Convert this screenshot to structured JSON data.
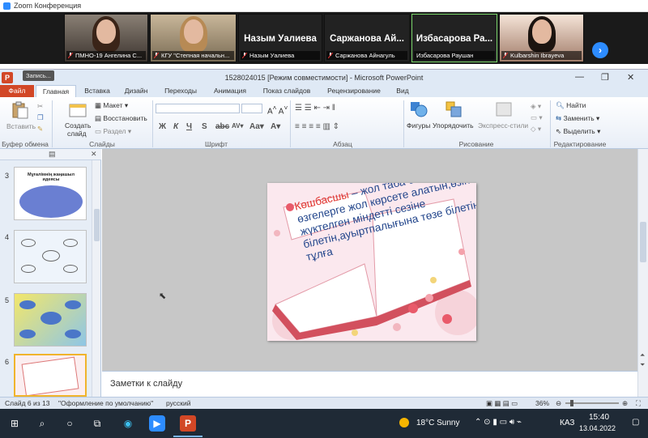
{
  "zoom": {
    "title": "Zoom Конференция",
    "participants": [
      {
        "label": "ПМНО-19 Ангелина С...",
        "name": ""
      },
      {
        "label": "КГУ \"Степная начальн...",
        "name": ""
      },
      {
        "label": "Назым Уалиева",
        "name": "Назым Уалиева"
      },
      {
        "label": "Саржанова Айнагуль",
        "name": "Саржанова Ай..."
      },
      {
        "label": "Избасарова Раушан",
        "name": "Избасарова Ра..."
      },
      {
        "label": "Kulbarshin Ibrayeva",
        "name": ""
      }
    ]
  },
  "powerpoint": {
    "record_label": "Запись...",
    "doc_title": "1528024015 [Режим совместимости] - Microsoft PowerPoint",
    "tabs": [
      "Файл",
      "Главная",
      "Вставка",
      "Дизайн",
      "Переходы",
      "Анимация",
      "Показ слайдов",
      "Рецензирование",
      "Вид"
    ],
    "ribbon": {
      "paste": "Вставить",
      "clipboard": "Буфер обмена",
      "create_slide_1": "Создать",
      "create_slide_2": "слайд",
      "layout": "Макет",
      "reset": "Восстановить",
      "section": "Раздел",
      "slides": "Слайды",
      "font": "Шрифт",
      "paragraph": "Абзац",
      "shapes": "Фигуры",
      "arrange": "Упорядочить",
      "express_styles": "Экспресс-стили",
      "drawing": "Рисование",
      "find": "Найти",
      "replace": "Заменить",
      "select": "Выделить",
      "editing": "Редактирование"
    },
    "thumbnails": [
      {
        "num": "3",
        "title": "Мұғалімнің жаңашыл идеясы"
      },
      {
        "num": "4"
      },
      {
        "num": "5"
      },
      {
        "num": "6"
      }
    ],
    "slide": {
      "highlight": "Көшбасшы",
      "text": " – жол таба білетін, өзгелерге жол көрсете алатын,өзіне жүктелген міндетті сезіне білетін,ауыртпалығына төзе білетін тұлға"
    },
    "notes_placeholder": "Заметки к слайду",
    "status": {
      "slide_info": "Слайд 6 из 13",
      "theme": "\"Оформление по умолчанию\"",
      "lang": "русский",
      "zoom": "36%"
    }
  },
  "taskbar": {
    "weather": "18°C  Sunny",
    "lang": "КАЗ",
    "time": "15:40",
    "date": "13.04.2022"
  }
}
